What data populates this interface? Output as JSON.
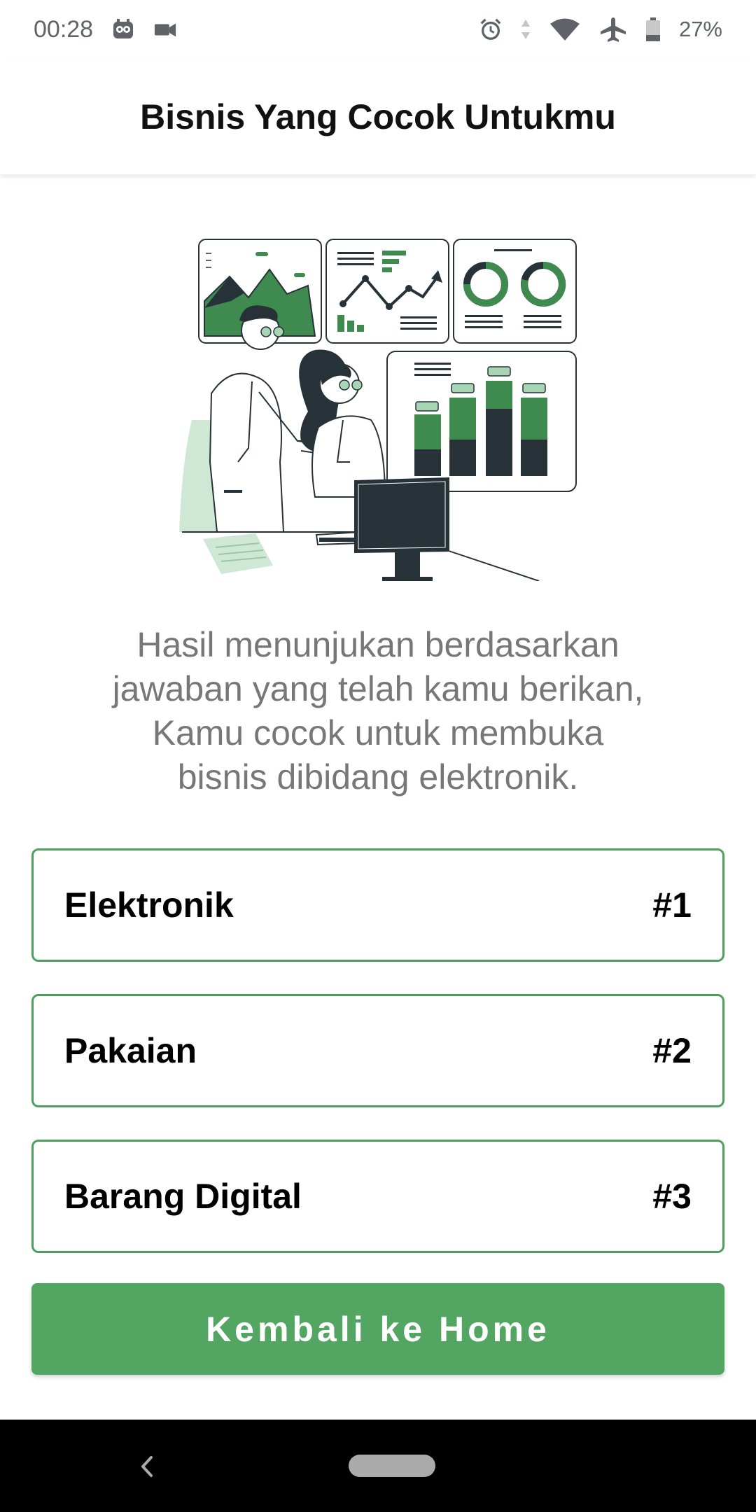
{
  "status_bar": {
    "time": "00:28",
    "battery": "27%",
    "icons": [
      "owl-icon",
      "video-camera-icon",
      "alarm-icon",
      "data-arrows-icon",
      "wifi-icon",
      "airplane-icon",
      "battery-icon"
    ]
  },
  "app_bar": {
    "title": "Bisnis Yang Cocok Untukmu"
  },
  "illustration": {
    "name": "business-analytics-illustration",
    "accent_color": "#3e8a4f",
    "light_color": "#cfe8d5",
    "dark_color": "#263238"
  },
  "description": {
    "line1": "Hasil menunjukan berdasarkan",
    "line2": "jawaban yang telah kamu berikan,",
    "line3": "Kamu cocok untuk membuka",
    "line4": "bisnis dibidang elektronik."
  },
  "results": [
    {
      "name": "Elektronik",
      "rank": "#1"
    },
    {
      "name": "Pakaian",
      "rank": "#2"
    },
    {
      "name": "Barang Digital",
      "rank": "#3"
    }
  ],
  "home_button": {
    "label": "Kembali ke Home"
  },
  "colors": {
    "primary": "#53a662",
    "card_border": "#4e9f5f",
    "description_text": "#777777"
  }
}
